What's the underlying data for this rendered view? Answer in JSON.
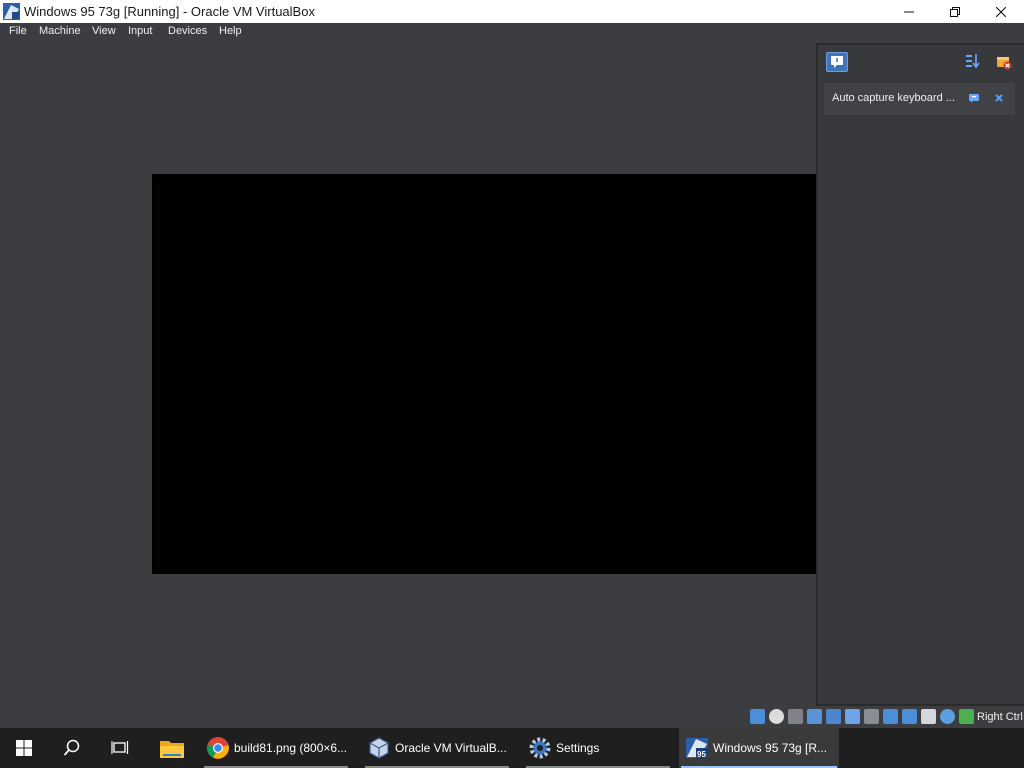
{
  "window": {
    "title": "Windows 95 73g [Running] - Oracle VM VirtualBox"
  },
  "menubar": {
    "items": [
      "File",
      "Machine",
      "View",
      "Input",
      "Devices",
      "Help"
    ]
  },
  "notification_center": {
    "icons": {
      "bell": "notification-bell-icon",
      "sort": "sort-icon",
      "clear": "clear-all-icon"
    },
    "notifications": [
      {
        "text": "Auto capture keyboard ...",
        "help_icon": "help-icon",
        "close_icon": "close-icon"
      }
    ]
  },
  "statusbar": {
    "icons": [
      "hard-disk-icon",
      "optical-drive-icon",
      "floppy-icon",
      "audio-icon",
      "network-icon",
      "usb-icon",
      "shared-folders-icon",
      "display-icon",
      "recording-icon",
      "cpu-icon",
      "virtualization-icon",
      "mouse-integration-icon",
      "keyboard-capture-icon"
    ],
    "host_key": "Right Ctrl"
  },
  "taskbar": {
    "pinned": [
      "windows-start-icon",
      "search-icon",
      "task-view-icon",
      "file-explorer-icon"
    ],
    "apps": [
      {
        "label": "build81.png (800×6...",
        "icon": "chrome-icon",
        "active": false
      },
      {
        "label": "Oracle VM VirtualB...",
        "icon": "virtualbox-icon",
        "active": false
      },
      {
        "label": "Settings",
        "icon": "settings-gear-icon",
        "active": false
      },
      {
        "label": "Windows 95 73g [R...",
        "icon": "vm-windows95-icon",
        "active": true
      }
    ]
  },
  "colors": {
    "background": "#3c3d40",
    "guest_screen": "#000000",
    "accent": "#3e74b8",
    "taskbar": "#1f1f1f"
  }
}
